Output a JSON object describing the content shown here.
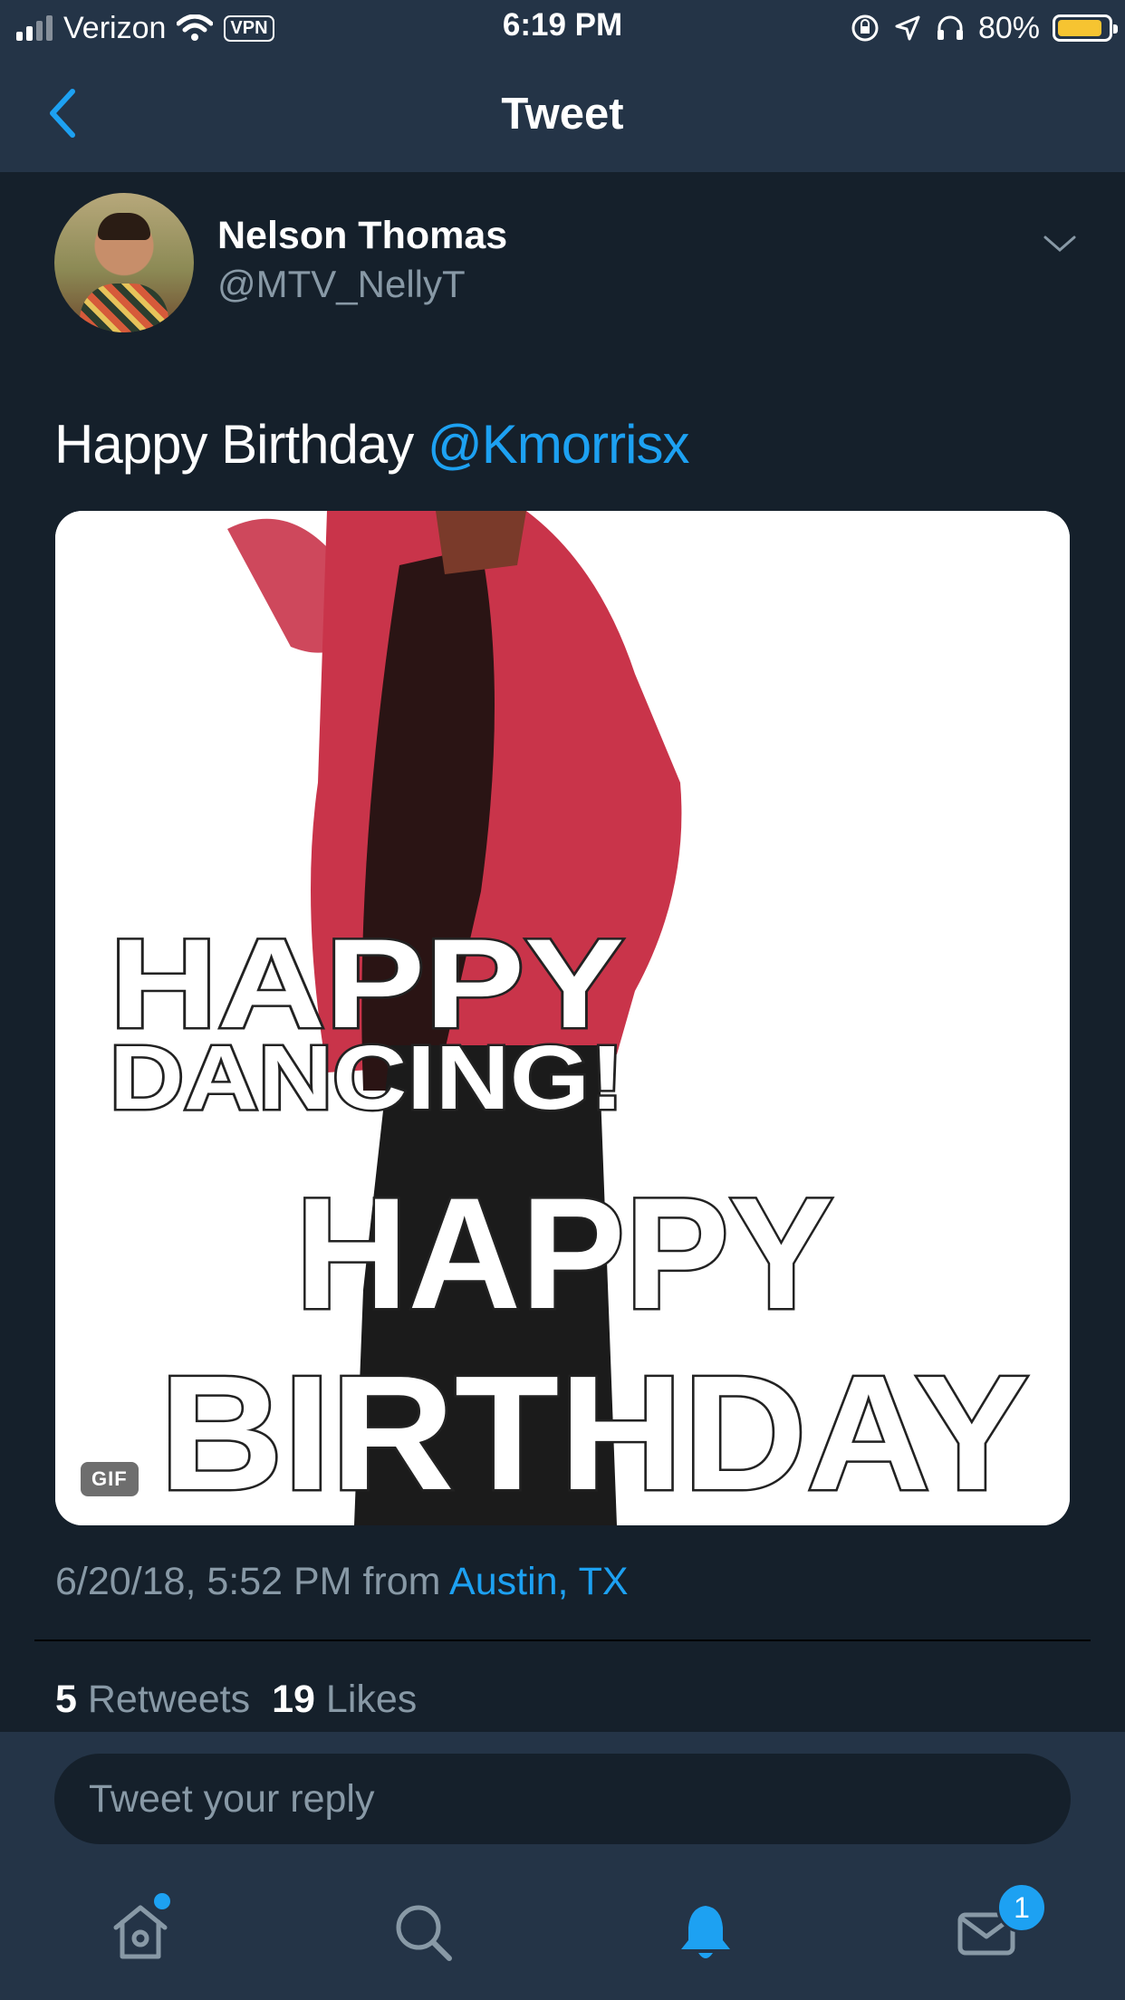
{
  "status_bar": {
    "carrier": "Verizon",
    "vpn": "VPN",
    "time": "6:19 PM",
    "battery_percent": "80%",
    "battery_level": 0.8,
    "battery_color": "#f6c431"
  },
  "header": {
    "title": "Tweet",
    "back_icon": "chevron-left-icon"
  },
  "tweet": {
    "author_name": "Nelson Thomas",
    "author_handle": "@MTV_NellyT",
    "text": "Happy Birthday ",
    "mention": "@Kmorrisx",
    "media": {
      "type": "GIF",
      "badge": "GIF",
      "caption_lines": [
        "HAPPY",
        "DANCING!",
        "HAPPY",
        "BIRTHDAY"
      ]
    },
    "timestamp": "6/20/18, 5:52 PM",
    "from_text": "from",
    "location": "Austin, TX",
    "retweets_count": "5",
    "retweets_label": "Retweets",
    "likes_count": "19",
    "likes_label": "Likes"
  },
  "reply": {
    "placeholder": "Tweet your reply"
  },
  "tab_bar": {
    "items": [
      {
        "name": "home",
        "icon": "home-icon",
        "has_dot": true
      },
      {
        "name": "search",
        "icon": "search-icon"
      },
      {
        "name": "notifications",
        "icon": "bell-icon",
        "active": true
      },
      {
        "name": "messages",
        "icon": "mail-icon",
        "badge": "1"
      }
    ]
  },
  "colors": {
    "background": "#15202b",
    "header": "#243447",
    "accent": "#1da1f2",
    "secondary_text": "#8899a6"
  }
}
